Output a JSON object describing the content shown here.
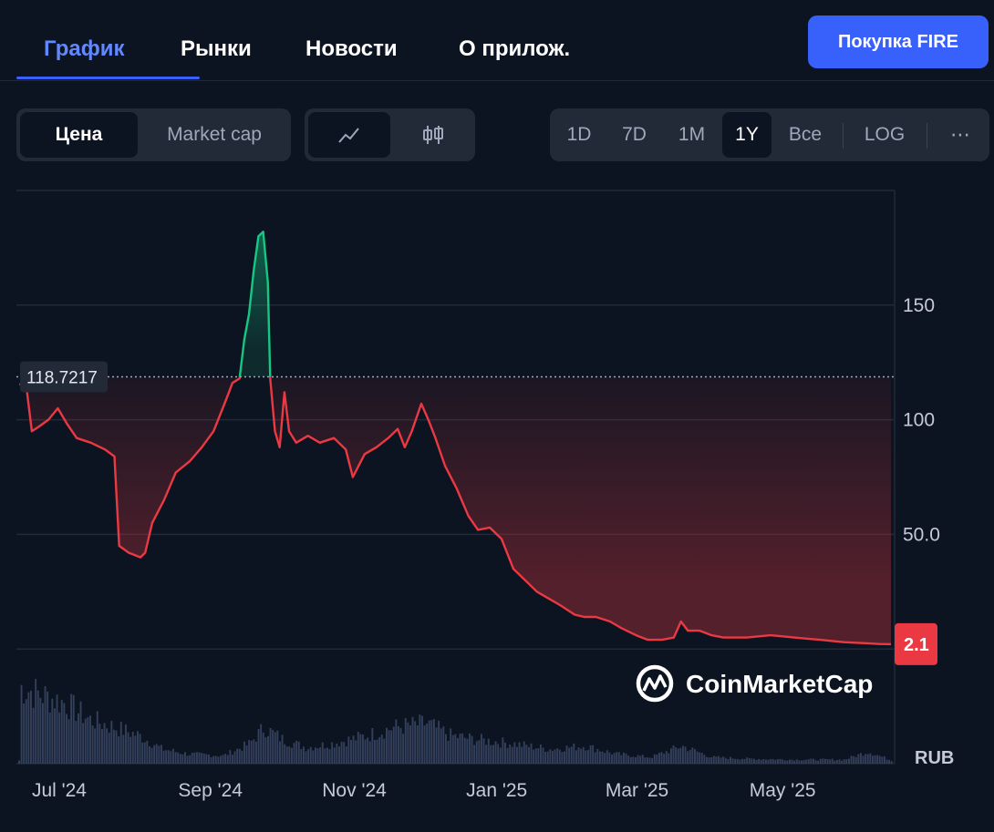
{
  "tabs": [
    {
      "label": "График",
      "active": true
    },
    {
      "label": "Рынки"
    },
    {
      "label": "Новости"
    },
    {
      "label": "О прилож."
    }
  ],
  "buy_button": "Покупка FIRE",
  "toolbar": {
    "metric": {
      "price": "Цена",
      "market_cap": "Market cap"
    },
    "chart_type_icons": [
      "line-chart-icon",
      "candlestick-icon"
    ],
    "ranges": [
      "1D",
      "7D",
      "1M",
      "1Y",
      "Все"
    ],
    "active_range": "1Y",
    "log": "LOG",
    "more": "⋯"
  },
  "watermark": "CoinMarketCap",
  "colors": {
    "up": "#16c784",
    "down": "#ea3943",
    "accent": "#3861fb",
    "volume": "#3b4866"
  },
  "chart_data": {
    "type": "line",
    "currency": "RUB",
    "baseline": 118.7217,
    "baseline_label": "118.7217",
    "current": 2.1,
    "current_label": "2.1",
    "yticks": [
      {
        "value": 150,
        "label": "150"
      },
      {
        "value": 100,
        "label": "100"
      },
      {
        "value": 50,
        "label": "50.0"
      }
    ],
    "ylim": [
      -50,
      200
    ],
    "x_dates_range": [
      "2024-06-26",
      "2025-06-30"
    ],
    "xticks": [
      {
        "date": "2024-07-01",
        "label": "Jul '24"
      },
      {
        "date": "2024-09-01",
        "label": "Sep '24"
      },
      {
        "date": "2024-11-01",
        "label": "Nov '24"
      },
      {
        "date": "2025-01-01",
        "label": "Jan '25"
      },
      {
        "date": "2025-03-01",
        "label": "Mar '25"
      },
      {
        "date": "2025-05-01",
        "label": "May '25"
      }
    ],
    "price": [
      [
        "2024-06-26",
        115
      ],
      [
        "2024-06-28",
        120
      ],
      [
        "2024-07-01",
        95
      ],
      [
        "2024-07-04",
        97
      ],
      [
        "2024-07-08",
        100
      ],
      [
        "2024-07-12",
        105
      ],
      [
        "2024-07-16",
        98
      ],
      [
        "2024-07-20",
        92
      ],
      [
        "2024-07-26",
        90
      ],
      [
        "2024-08-01",
        87
      ],
      [
        "2024-08-05",
        84
      ],
      [
        "2024-08-07",
        45
      ],
      [
        "2024-08-11",
        42
      ],
      [
        "2024-08-16",
        40
      ],
      [
        "2024-08-18",
        42
      ],
      [
        "2024-08-21",
        55
      ],
      [
        "2024-08-26",
        65
      ],
      [
        "2024-08-31",
        77
      ],
      [
        "2024-09-06",
        82
      ],
      [
        "2024-09-11",
        88
      ],
      [
        "2024-09-16",
        95
      ],
      [
        "2024-09-21",
        108
      ],
      [
        "2024-09-24",
        116
      ],
      [
        "2024-09-27",
        118
      ],
      [
        "2024-09-29",
        135
      ],
      [
        "2024-10-01",
        146
      ],
      [
        "2024-10-03",
        165
      ],
      [
        "2024-10-05",
        180
      ],
      [
        "2024-10-07",
        182
      ],
      [
        "2024-10-09",
        160
      ],
      [
        "2024-10-10",
        118
      ],
      [
        "2024-10-12",
        95
      ],
      [
        "2024-10-14",
        88
      ],
      [
        "2024-10-16",
        112
      ],
      [
        "2024-10-18",
        95
      ],
      [
        "2024-10-21",
        90
      ],
      [
        "2024-10-26",
        93
      ],
      [
        "2024-10-31",
        90
      ],
      [
        "2024-11-06",
        92
      ],
      [
        "2024-11-11",
        87
      ],
      [
        "2024-11-14",
        75
      ],
      [
        "2024-11-19",
        85
      ],
      [
        "2024-11-24",
        88
      ],
      [
        "2024-11-29",
        92
      ],
      [
        "2024-12-03",
        96
      ],
      [
        "2024-12-06",
        88
      ],
      [
        "2024-12-09",
        95
      ],
      [
        "2024-12-13",
        107
      ],
      [
        "2024-12-16",
        100
      ],
      [
        "2024-12-19",
        92
      ],
      [
        "2024-12-23",
        80
      ],
      [
        "2024-12-28",
        70
      ],
      [
        "2025-01-02",
        58
      ],
      [
        "2025-01-06",
        52
      ],
      [
        "2025-01-11",
        53
      ],
      [
        "2025-01-16",
        48
      ],
      [
        "2025-01-21",
        35
      ],
      [
        "2025-01-26",
        30
      ],
      [
        "2025-01-31",
        25
      ],
      [
        "2025-02-05",
        22
      ],
      [
        "2025-02-10",
        19
      ],
      [
        "2025-02-16",
        15
      ],
      [
        "2025-02-20",
        14
      ],
      [
        "2025-02-25",
        14
      ],
      [
        "2025-03-03",
        12
      ],
      [
        "2025-03-08",
        9
      ],
      [
        "2025-03-14",
        6
      ],
      [
        "2025-03-19",
        4
      ],
      [
        "2025-03-25",
        4
      ],
      [
        "2025-03-30",
        5
      ],
      [
        "2025-04-02",
        12
      ],
      [
        "2025-04-05",
        8
      ],
      [
        "2025-04-10",
        8
      ],
      [
        "2025-04-15",
        6
      ],
      [
        "2025-04-20",
        5
      ],
      [
        "2025-04-30",
        5
      ],
      [
        "2025-05-10",
        6
      ],
      [
        "2025-05-20",
        5
      ],
      [
        "2025-05-31",
        4
      ],
      [
        "2025-06-10",
        3
      ],
      [
        "2025-06-20",
        2.5
      ],
      [
        "2025-06-25",
        2.2
      ],
      [
        "2025-06-30",
        2.1
      ]
    ],
    "volume_relative": [
      [
        "2024-06-26",
        0.95
      ],
      [
        "2024-07-05",
        0.85
      ],
      [
        "2024-07-15",
        0.75
      ],
      [
        "2024-07-25",
        0.55
      ],
      [
        "2024-08-05",
        0.45
      ],
      [
        "2024-08-15",
        0.35
      ],
      [
        "2024-08-25",
        0.18
      ],
      [
        "2024-09-05",
        0.12
      ],
      [
        "2024-09-20",
        0.1
      ],
      [
        "2024-10-01",
        0.25
      ],
      [
        "2024-10-07",
        0.45
      ],
      [
        "2024-10-15",
        0.3
      ],
      [
        "2024-10-25",
        0.2
      ],
      [
        "2024-11-05",
        0.25
      ],
      [
        "2024-11-20",
        0.35
      ],
      [
        "2024-12-01",
        0.45
      ],
      [
        "2024-12-15",
        0.5
      ],
      [
        "2024-12-25",
        0.35
      ],
      [
        "2025-01-05",
        0.3
      ],
      [
        "2025-01-20",
        0.25
      ],
      [
        "2025-02-05",
        0.18
      ],
      [
        "2025-02-20",
        0.22
      ],
      [
        "2025-03-05",
        0.12
      ],
      [
        "2025-03-20",
        0.08
      ],
      [
        "2025-04-02",
        0.22
      ],
      [
        "2025-04-15",
        0.08
      ],
      [
        "2025-05-01",
        0.06
      ],
      [
        "2025-05-20",
        0.05
      ],
      [
        "2025-06-10",
        0.05
      ],
      [
        "2025-06-20",
        0.15
      ],
      [
        "2025-06-30",
        0.04
      ]
    ]
  }
}
